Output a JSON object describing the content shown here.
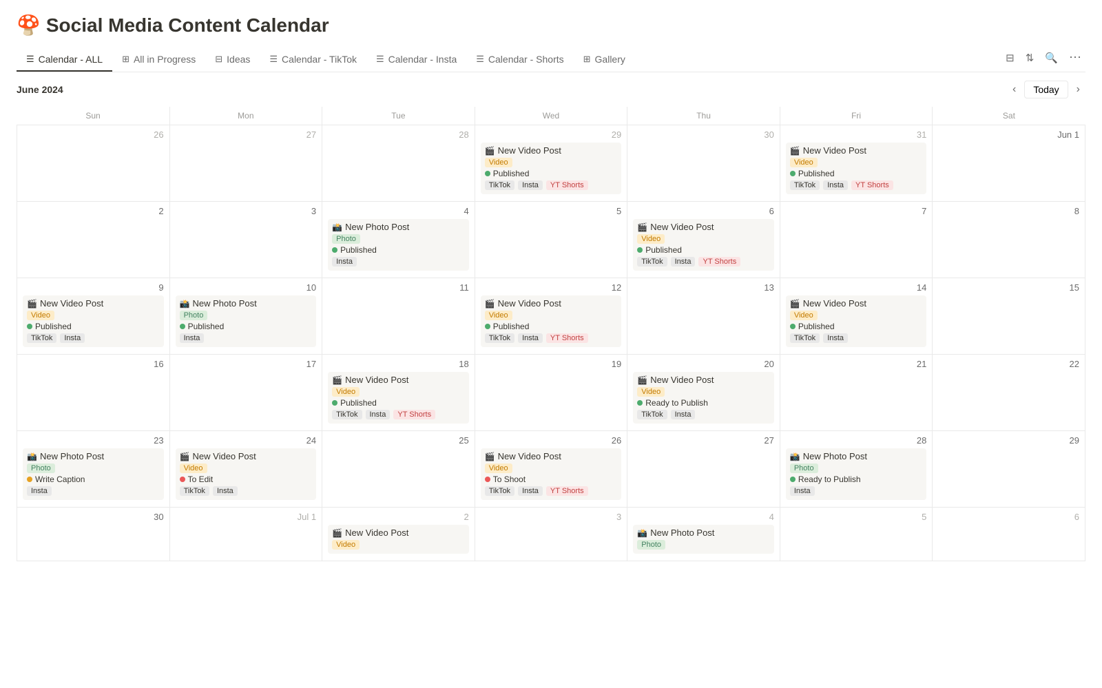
{
  "title": "Social Media Content Calendar",
  "emoji": "🍄",
  "tabs": [
    {
      "id": "calendar-all",
      "label": "Calendar - ALL",
      "icon": "☰",
      "active": true
    },
    {
      "id": "all-in-progress",
      "label": "All in Progress",
      "icon": "⊞",
      "active": false
    },
    {
      "id": "ideas",
      "label": "Ideas",
      "icon": "⊟",
      "active": false
    },
    {
      "id": "calendar-tiktok",
      "label": "Calendar - TikTok",
      "icon": "☰",
      "active": false
    },
    {
      "id": "calendar-insta",
      "label": "Calendar - Insta",
      "icon": "☰",
      "active": false
    },
    {
      "id": "calendar-shorts",
      "label": "Calendar - Shorts",
      "icon": "☰",
      "active": false
    },
    {
      "id": "gallery",
      "label": "Gallery",
      "icon": "⊞",
      "active": false
    }
  ],
  "month": "June 2024",
  "today_label": "Today",
  "days": [
    "Sun",
    "Mon",
    "Tue",
    "Wed",
    "Thu",
    "Fri",
    "Sat"
  ],
  "events": {
    "may29": {
      "title": "New Video Post",
      "emoji": "🎬",
      "type": "Video",
      "status": "Published",
      "status_type": "published",
      "platforms": [
        "TikTok",
        "Insta",
        "YT Shorts"
      ]
    },
    "may31": {
      "title": "New Video Post",
      "emoji": "🎬",
      "type": "Video",
      "status": "Published",
      "status_type": "published",
      "platforms": [
        "TikTok",
        "Insta",
        "YT Shorts"
      ]
    },
    "jun4": {
      "title": "New Photo Post",
      "emoji": "📸",
      "type": "Photo",
      "status": "Published",
      "status_type": "published",
      "platforms": [
        "Insta"
      ]
    },
    "jun6": {
      "title": "New Video Post",
      "emoji": "🎬",
      "type": "Video",
      "status": "Published",
      "status_type": "published",
      "platforms": [
        "TikTok",
        "Insta",
        "YT Shorts"
      ]
    },
    "jun9": {
      "title": "New Video Post",
      "emoji": "🎬",
      "type": "Video",
      "status": "Published",
      "status_type": "published",
      "platforms": [
        "TikTok",
        "Insta"
      ]
    },
    "jun10": {
      "title": "New Photo Post",
      "emoji": "📸",
      "type": "Photo",
      "status": "Published",
      "status_type": "published",
      "platforms": [
        "Insta"
      ]
    },
    "jun12": {
      "title": "New Video Post",
      "emoji": "🎬",
      "type": "Video",
      "status": "Published",
      "status_type": "published",
      "platforms": [
        "TikTok",
        "Insta",
        "YT Shorts"
      ]
    },
    "jun14": {
      "title": "New Video Post",
      "emoji": "🎬",
      "type": "Video",
      "status": "Published",
      "status_type": "published",
      "platforms": [
        "TikTok",
        "Insta"
      ]
    },
    "jun18": {
      "title": "New Video Post",
      "emoji": "🎬",
      "type": "Video",
      "status": "Published",
      "status_type": "published",
      "platforms": [
        "TikTok",
        "Insta",
        "YT Shorts"
      ]
    },
    "jun20": {
      "title": "New Video Post",
      "emoji": "🎬",
      "type": "Video",
      "status": "Ready to Publish",
      "status_type": "ready",
      "platforms": [
        "TikTok",
        "Insta"
      ]
    },
    "jun23": {
      "title": "New Photo Post",
      "emoji": "📸",
      "type": "Photo",
      "status": "Write Caption",
      "status_type": "write-caption",
      "platforms": [
        "Insta"
      ]
    },
    "jun24": {
      "title": "New Video Post",
      "emoji": "🎬",
      "type": "Video",
      "status": "To Edit",
      "status_type": "to-edit",
      "platforms": [
        "TikTok",
        "Insta"
      ]
    },
    "jun26": {
      "title": "New Video Post",
      "emoji": "🎬",
      "type": "Video",
      "status": "To Shoot",
      "status_type": "to-shoot",
      "platforms": [
        "TikTok",
        "Insta",
        "YT Shorts"
      ]
    },
    "jun28": {
      "title": "New Photo Post",
      "emoji": "📸",
      "type": "Photo",
      "status": "Ready to Publish",
      "status_type": "ready",
      "platforms": [
        "Insta"
      ]
    },
    "jul2": {
      "title": "New Video Post",
      "emoji": "🎬",
      "type": "Video",
      "status": "",
      "status_type": "",
      "platforms": []
    },
    "jul4": {
      "title": "New Photo Post",
      "emoji": "📸",
      "type": "Photo",
      "status": "",
      "status_type": "",
      "platforms": []
    }
  },
  "labels": {
    "published": "Published",
    "ready_to_publish": "Ready to Publish",
    "to_edit": "To Edit",
    "to_shoot": "To Shoot",
    "write_caption": "Write Caption"
  }
}
